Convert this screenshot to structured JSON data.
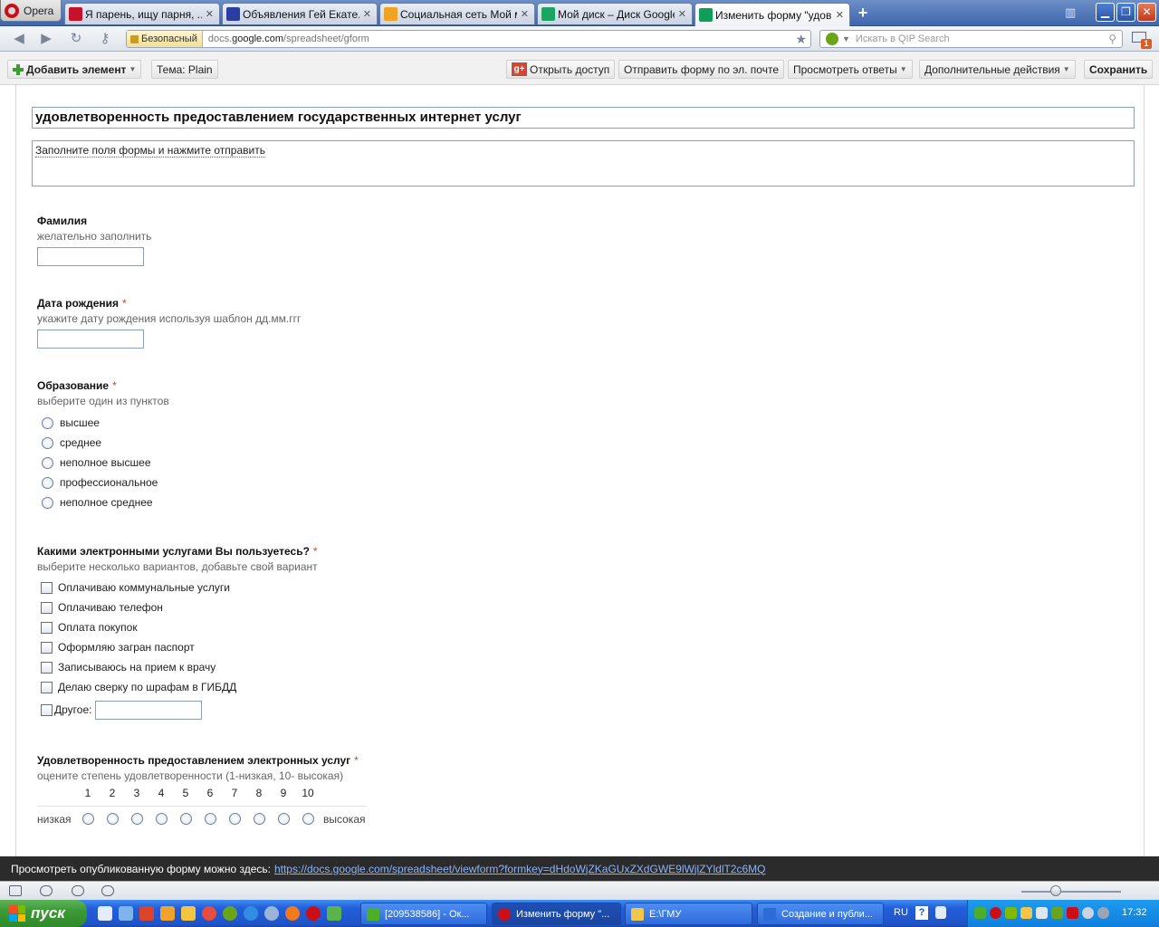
{
  "browser": {
    "menu_label": "Opera",
    "tabs": [
      {
        "title": "Я парень, ищу парня, ...",
        "color": "#c7102a"
      },
      {
        "title": "Объявления Гей Екате...",
        "color": "#2b3da0"
      },
      {
        "title": "Социальная сеть Мой м...",
        "color": "#f0a323"
      },
      {
        "title": "Мой диск – Диск Google",
        "color": "#1da462"
      },
      {
        "title": "Изменить форму \"удов...",
        "color": "#0f9d58"
      }
    ],
    "close_glyph": "✕",
    "newtab_glyph": "+",
    "address": {
      "security_label": "Безопасный",
      "url_domain_pre": "docs.",
      "url_domain_main": "google.com",
      "url_path": "/spreadsheet/gform"
    },
    "search_placeholder": "Искать в QIP Search",
    "mail_badge": "1",
    "window_controls": {
      "minimize": "▁",
      "restore": "❐",
      "close": "✕"
    }
  },
  "toolbar": {
    "add_element": "Добавить элемент",
    "theme": "Тема:  Plain",
    "share": "Открыть доступ",
    "email_form": "Отправить форму по эл. почте",
    "view_responses": "Просмотреть ответы",
    "more_actions": "Дополнительные действия",
    "save": "Сохранить"
  },
  "form": {
    "title": "удовлетворенность предоставлением государственных интернет услуг",
    "description": "Заполните поля формы и нажмите отправить",
    "q1": {
      "title": "Фамилия",
      "help": "желательно заполнить"
    },
    "q2": {
      "title": "Дата рождения",
      "help": "укажите дату рождения используя шаблон дд.мм.ггг",
      "req": "*"
    },
    "q3": {
      "title": "Образование",
      "help": "выберите один из пунктов",
      "req": "*",
      "options": [
        "высшее",
        "среднее",
        "неполное высшее",
        "профессиональное",
        "неполное среднее"
      ]
    },
    "q4": {
      "title": "Какими электронными услугами Вы пользуетесь?",
      "help": "выберите несколько вариантов, добавьте свой вариант",
      "req": "*",
      "options": [
        "Оплачиваю коммунальные услуги",
        "Оплачиваю телефон",
        "Оплата покупок",
        "Оформляю загран паспорт",
        "Записываюсь на прием к врачу",
        "Делаю сверку по шрафам в ГИБДД"
      ],
      "other_label": "Другое:"
    },
    "q5": {
      "title": "Удовлетворенность предоставлением электронных услуг",
      "help": "оцените степень удовлетворенности (1-низкая, 10- высокая)",
      "req": "*",
      "scale": [
        "1",
        "2",
        "3",
        "4",
        "5",
        "6",
        "7",
        "8",
        "9",
        "10"
      ],
      "low_label": "низкая",
      "high_label": "высокая"
    }
  },
  "notice": {
    "text": "Просмотреть опубликованную форму можно здесь:",
    "link": "https://docs.google.com/spreadsheet/viewform?formkey=dHdoWjZKaGUxZXdGWE9lWjlZYldlT2c6MQ"
  },
  "taskbar": {
    "start_label": "пуск",
    "tasks": [
      {
        "title": "[209538586] - Ок...",
        "color": "#4caf2a"
      },
      {
        "title": "Изменить форму \"...",
        "color": "#cc0f16"
      },
      {
        "title": "E:\\ГМУ",
        "color": "#f2c649"
      },
      {
        "title": "Создание и публи...",
        "color": "#2b6cd8"
      }
    ],
    "lang": "RU",
    "help": "?",
    "clock": "17:32"
  }
}
